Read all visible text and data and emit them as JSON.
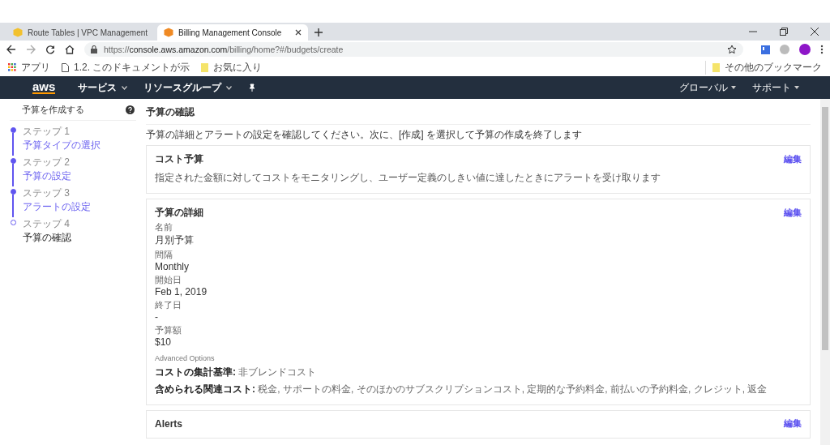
{
  "browser": {
    "tabs": [
      {
        "title": "Route Tables | VPC Management",
        "selected": false,
        "color": "#f2c12e"
      },
      {
        "title": "Billing Management Console",
        "selected": true,
        "color": "#f08a24"
      }
    ],
    "url": {
      "scheme": "https://",
      "host": "console.aws.amazon.com",
      "path": "/billing/home?#/budgets/create"
    },
    "bookmarks": [
      {
        "label": "アプリ",
        "kind": "apps"
      },
      {
        "label": "1.2. このドキュメントが示",
        "kind": "page"
      },
      {
        "label": "お気に入り",
        "kind": "folder"
      }
    ],
    "other_bookmarks": "その他のブックマーク"
  },
  "navbar": {
    "logo": "aws",
    "menus": [
      "サービス",
      "リソースグループ"
    ],
    "right_menus": [
      "グローバル",
      "サポート"
    ]
  },
  "sidebar": {
    "title": "予算を作成する",
    "steps": [
      {
        "label": "ステップ 1",
        "name": "予算タイプの選択",
        "selected": false
      },
      {
        "label": "ステップ 2",
        "name": "予算の設定",
        "selected": false
      },
      {
        "label": "ステップ 3",
        "name": "アラートの設定",
        "selected": false
      },
      {
        "label": "ステップ 4",
        "name": "予算の確認",
        "selected": true
      }
    ]
  },
  "main": {
    "title": "予算の確認",
    "intro": "予算の詳細とアラートの設定を確認してください。次に、[作成] を選択して予算の作成を終了します",
    "cards": [
      {
        "title": "コスト予算",
        "edit": "編集",
        "description": "指定された金額に対してコストをモニタリングし、ユーザー定義のしきい値に達したときにアラートを受け取ります"
      },
      {
        "title": "予算の詳細",
        "edit": "編集",
        "fields": [
          {
            "label": "名前",
            "value": "月別予算"
          },
          {
            "label": "間隔",
            "value": "Monthly"
          },
          {
            "label": "開始日",
            "value": "Feb 1, 2019"
          },
          {
            "label": "終了日",
            "value": "-"
          },
          {
            "label": "予算額",
            "value": "$10"
          }
        ],
        "advanced_label": "Advanced Options",
        "options": [
          {
            "label": "コストの集計基準:",
            "value": "非ブレンドコスト"
          },
          {
            "label": "含められる関連コスト:",
            "value": "税金, サポートの料金, そのほかのサブスクリプションコスト, 定期的な予約料金, 前払いの予約料金, クレジット, 返金"
          }
        ]
      },
      {
        "title": "Alerts",
        "edit": "編集"
      }
    ]
  }
}
